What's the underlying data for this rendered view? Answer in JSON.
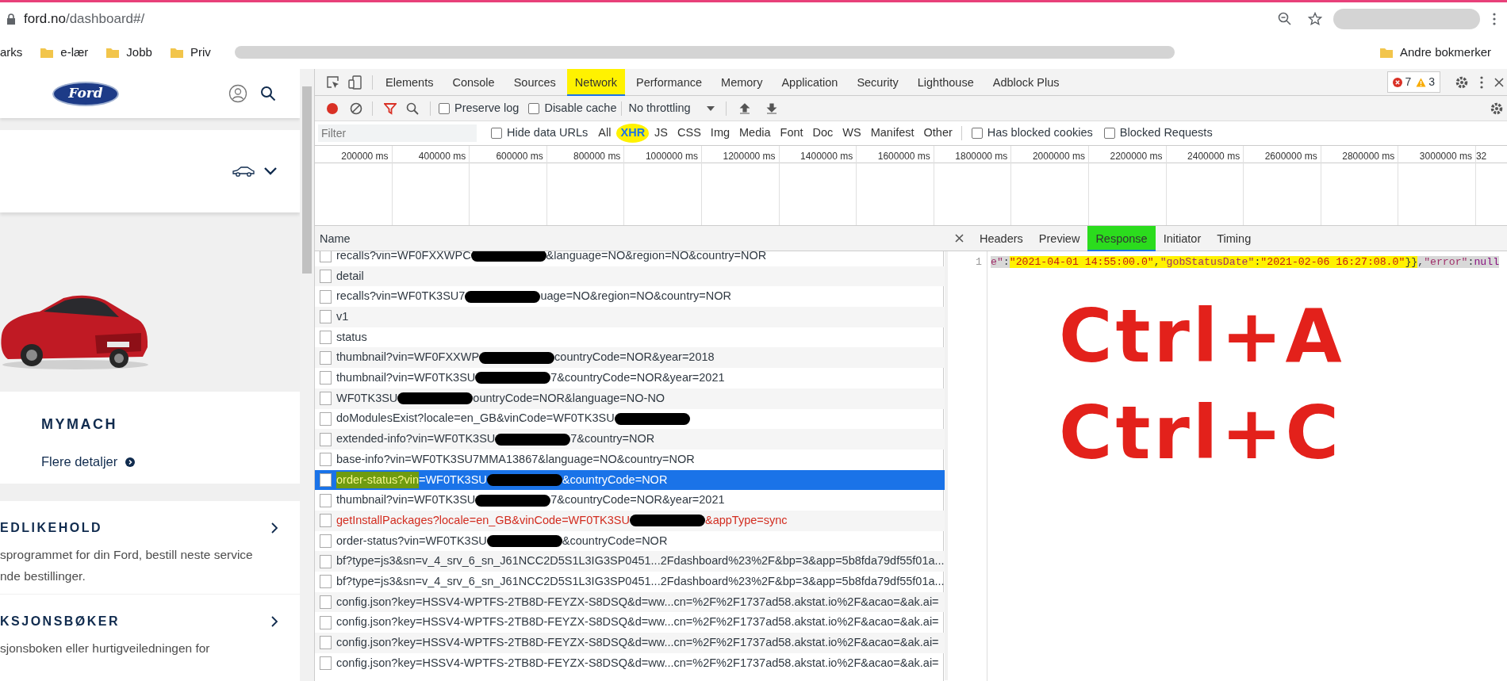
{
  "browser": {
    "url_host": "ford.no",
    "url_path": "/dashboard#/",
    "bookmarks": [
      {
        "label": "arks",
        "folder": false
      },
      {
        "label": "e-lær",
        "folder": true
      },
      {
        "label": "Jobb",
        "folder": true
      },
      {
        "label": "Priv",
        "folder": true
      }
    ],
    "other_bookmarks": "Andre bokmerker"
  },
  "site": {
    "logo": "Ford",
    "vehicle_name": "MYMACH",
    "details_link": "Flere detaljer",
    "sections": [
      {
        "title": "EDLIKEHOLD",
        "lines": [
          "sprogrammet for din Ford, bestill neste service",
          "nde bestillinger."
        ]
      },
      {
        "title": "KSJONSBØKER",
        "lines": [
          "sjonsboken eller hurtigveiledningen for"
        ]
      }
    ]
  },
  "devtools": {
    "tabs": [
      {
        "label": "Elements",
        "selected": false,
        "highlighted": false
      },
      {
        "label": "Console",
        "selected": false,
        "highlighted": false
      },
      {
        "label": "Sources",
        "selected": false,
        "highlighted": false
      },
      {
        "label": "Network",
        "selected": true,
        "highlighted": true
      },
      {
        "label": "Performance",
        "selected": false,
        "highlighted": false
      },
      {
        "label": "Memory",
        "selected": false,
        "highlighted": false
      },
      {
        "label": "Application",
        "selected": false,
        "highlighted": false
      },
      {
        "label": "Security",
        "selected": false,
        "highlighted": false
      },
      {
        "label": "Lighthouse",
        "selected": false,
        "highlighted": false
      },
      {
        "label": "Adblock Plus",
        "selected": false,
        "highlighted": false
      }
    ],
    "error_count": "7",
    "warning_count": "3",
    "toolbar": {
      "recording": true,
      "filter_active": true,
      "checkboxes": [
        {
          "label": "Preserve log",
          "checked": false
        },
        {
          "label": "Disable cache",
          "checked": false
        }
      ],
      "throttling": "No throttling"
    },
    "filter": {
      "placeholder": "Filter",
      "hide_data_urls": {
        "label": "Hide data URLs",
        "checked": false
      },
      "types": [
        {
          "label": "All",
          "selected": false,
          "highlighted": false
        },
        {
          "label": "XHR",
          "selected": true,
          "highlighted": true
        },
        {
          "label": "JS",
          "selected": false,
          "highlighted": false
        },
        {
          "label": "CSS",
          "selected": false,
          "highlighted": false
        },
        {
          "label": "Img",
          "selected": false,
          "highlighted": false
        },
        {
          "label": "Media",
          "selected": false,
          "highlighted": false
        },
        {
          "label": "Font",
          "selected": false,
          "highlighted": false
        },
        {
          "label": "Doc",
          "selected": false,
          "highlighted": false
        },
        {
          "label": "WS",
          "selected": false,
          "highlighted": false
        },
        {
          "label": "Manifest",
          "selected": false,
          "highlighted": false
        },
        {
          "label": "Other",
          "selected": false,
          "highlighted": false
        }
      ],
      "blocked_filters": [
        {
          "label": "Has blocked cookies",
          "checked": false
        },
        {
          "label": "Blocked Requests",
          "checked": false
        }
      ]
    },
    "timeline_ticks": [
      "200000 ms",
      "400000 ms",
      "600000 ms",
      "800000 ms",
      "1000000 ms",
      "1200000 ms",
      "1400000 ms",
      "1600000 ms",
      "1800000 ms",
      "2000000 ms",
      "2200000 ms",
      "2400000 ms",
      "2600000 ms",
      "2800000 ms",
      "3000000 ms",
      "32"
    ],
    "name_column": "Name",
    "requests": [
      {
        "selected": false,
        "failed": false,
        "segments": [
          {
            "kind": "text",
            "text": "recalls?vin=WF0FXXWPC"
          },
          {
            "kind": "redaction"
          },
          {
            "kind": "text",
            "text": "&language=NO&region=NO&country=NOR"
          }
        ]
      },
      {
        "selected": false,
        "failed": false,
        "segments": [
          {
            "kind": "text",
            "text": "detail"
          }
        ]
      },
      {
        "selected": false,
        "failed": false,
        "segments": [
          {
            "kind": "text",
            "text": "recalls?vin=WF0TK3SU7"
          },
          {
            "kind": "redaction"
          },
          {
            "kind": "text",
            "text": "uage=NO&region=NO&country=NOR"
          }
        ]
      },
      {
        "selected": false,
        "failed": false,
        "segments": [
          {
            "kind": "text",
            "text": "v1"
          }
        ]
      },
      {
        "selected": false,
        "failed": false,
        "segments": [
          {
            "kind": "text",
            "text": "status"
          }
        ]
      },
      {
        "selected": false,
        "failed": false,
        "segments": [
          {
            "kind": "text",
            "text": "thumbnail?vin=WF0FXXWP"
          },
          {
            "kind": "redaction"
          },
          {
            "kind": "text",
            "text": "countryCode=NOR&year=2018"
          }
        ]
      },
      {
        "selected": false,
        "failed": false,
        "segments": [
          {
            "kind": "text",
            "text": "thumbnail?vin=WF0TK3SU"
          },
          {
            "kind": "redaction"
          },
          {
            "kind": "text",
            "text": "7&countryCode=NOR&year=2021"
          }
        ]
      },
      {
        "selected": false,
        "failed": false,
        "segments": [
          {
            "kind": "text",
            "text": "WF0TK3SU"
          },
          {
            "kind": "redaction"
          },
          {
            "kind": "text",
            "text": "ountryCode=NOR&language=NO-NO"
          }
        ]
      },
      {
        "selected": false,
        "failed": false,
        "segments": [
          {
            "kind": "text",
            "text": "doModulesExist?locale=en_GB&vinCode=WF0TK3SU"
          },
          {
            "kind": "redaction"
          }
        ]
      },
      {
        "selected": false,
        "failed": false,
        "segments": [
          {
            "kind": "text",
            "text": "extended-info?vin=WF0TK3SU"
          },
          {
            "kind": "redaction"
          },
          {
            "kind": "text",
            "text": "7&country=NOR"
          }
        ]
      },
      {
        "selected": false,
        "failed": false,
        "segments": [
          {
            "kind": "text",
            "text": "base-info?vin=WF0TK3SU7MMA13867&language=NO&country=NOR"
          }
        ]
      },
      {
        "selected": true,
        "failed": false,
        "segments": [
          {
            "kind": "text",
            "text": "order-status?vin",
            "highlighted": true
          },
          {
            "kind": "text",
            "text": "=WF0TK3SU"
          },
          {
            "kind": "redaction"
          },
          {
            "kind": "text",
            "text": "&countryCode=NOR"
          }
        ]
      },
      {
        "selected": false,
        "failed": false,
        "segments": [
          {
            "kind": "text",
            "text": "thumbnail?vin=WF0TK3SU"
          },
          {
            "kind": "redaction"
          },
          {
            "kind": "text",
            "text": "7&countryCode=NOR&year=2021"
          }
        ]
      },
      {
        "selected": false,
        "failed": true,
        "segments": [
          {
            "kind": "text",
            "text": "getInstallPackages?locale=en_GB&vinCode=WF0TK3SU"
          },
          {
            "kind": "redaction"
          },
          {
            "kind": "text",
            "text": "&appType=sync"
          }
        ]
      },
      {
        "selected": false,
        "failed": false,
        "segments": [
          {
            "kind": "text",
            "text": "order-status?vin=WF0TK3SU"
          },
          {
            "kind": "redaction"
          },
          {
            "kind": "text",
            "text": "&countryCode=NOR"
          }
        ]
      },
      {
        "selected": false,
        "failed": false,
        "segments": [
          {
            "kind": "text",
            "text": "bf?type=js3&sn=v_4_srv_6_sn_J61NCC2D5S1L3IG3SP0451...2Fdashboard%23%2F&bp=3&app=5b8fda79df55f01a..."
          }
        ]
      },
      {
        "selected": false,
        "failed": false,
        "segments": [
          {
            "kind": "text",
            "text": "bf?type=js3&sn=v_4_srv_6_sn_J61NCC2D5S1L3IG3SP0451...2Fdashboard%23%2F&bp=3&app=5b8fda79df55f01a..."
          }
        ]
      },
      {
        "selected": false,
        "failed": false,
        "segments": [
          {
            "kind": "text",
            "text": "config.json?key=HSSV4-WPTFS-2TB8D-FEYZX-S8DSQ&d=ww...cn=%2F%2F1737ad58.akstat.io%2F&acao=&ak.ai="
          }
        ]
      },
      {
        "selected": false,
        "failed": false,
        "segments": [
          {
            "kind": "text",
            "text": "config.json?key=HSSV4-WPTFS-2TB8D-FEYZX-S8DSQ&d=ww...cn=%2F%2F1737ad58.akstat.io%2F&acao=&ak.ai="
          }
        ]
      },
      {
        "selected": false,
        "failed": false,
        "segments": [
          {
            "kind": "text",
            "text": "config.json?key=HSSV4-WPTFS-2TB8D-FEYZX-S8DSQ&d=ww...cn=%2F%2F1737ad58.akstat.io%2F&acao=&ak.ai="
          }
        ]
      },
      {
        "selected": false,
        "failed": false,
        "segments": [
          {
            "kind": "text",
            "text": "config.json?key=HSSV4-WPTFS-2TB8D-FEYZX-S8DSQ&d=ww...cn=%2F%2F1737ad58.akstat.io%2F&acao=&ak.ai="
          }
        ]
      }
    ],
    "detail_tabs": [
      {
        "label": "Headers",
        "selected": false,
        "highlighted": false
      },
      {
        "label": "Preview",
        "selected": false,
        "highlighted": false
      },
      {
        "label": "Response",
        "selected": true,
        "highlighted": true
      },
      {
        "label": "Initiator",
        "selected": false,
        "highlighted": false
      },
      {
        "label": "Timing",
        "selected": false,
        "highlighted": false
      }
    ],
    "response": {
      "line_number": "1",
      "text_selected": true,
      "tokens": [
        {
          "kind": "key",
          "text": "e\"",
          "highlighted": false
        },
        {
          "kind": "punct",
          "text": ":",
          "highlighted": false
        },
        {
          "kind": "string",
          "text": "\"2021-04-01 14:55:00.0\"",
          "highlighted": true
        },
        {
          "kind": "punct",
          "text": ",",
          "highlighted": true
        },
        {
          "kind": "key",
          "text": "\"gobStatusDate\"",
          "highlighted": true
        },
        {
          "kind": "punct",
          "text": ":",
          "highlighted": true
        },
        {
          "kind": "string",
          "text": "\"2021-02-06 16:27:08.0\"",
          "highlighted": true
        },
        {
          "kind": "punct",
          "text": "}}",
          "highlighted": true
        },
        {
          "kind": "punct",
          "text": ",",
          "highlighted": false
        },
        {
          "kind": "key",
          "text": "\"error\"",
          "highlighted": false
        },
        {
          "kind": "punct",
          "text": ":",
          "highlighted": false
        },
        {
          "kind": "literal",
          "text": "null",
          "highlighted": false
        }
      ]
    }
  },
  "annotations": [
    "Ctrl+A",
    "Ctrl+C"
  ]
}
